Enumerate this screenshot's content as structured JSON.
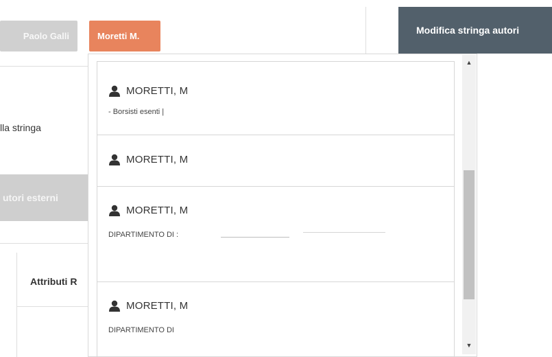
{
  "chips": {
    "first": "Paolo Galli",
    "selected": "Moretti M."
  },
  "modify_button": "Modifica stringa autori",
  "background": {
    "left_label": "lla stringa",
    "external_authors_button": "utori esterni",
    "table_header": "Attributi R"
  },
  "dropdown": {
    "items": [
      {
        "name": "MORETTI, M",
        "detail": "- Borsisti esenti |"
      },
      {
        "name": "MORETTI, M",
        "detail": ""
      },
      {
        "name": "MORETTI, M",
        "detail": "DIPARTIMENTO DI :"
      },
      {
        "name": "MORETTI, M",
        "detail": "DIPARTIMENTO DI"
      }
    ],
    "scroll_up_glyph": "▲",
    "scroll_down_glyph": "▼"
  },
  "colors": {
    "selected_chip": "#e8845d",
    "modify_button_bg": "#52606b",
    "inactive_chip": "#d0d0d0"
  },
  "icons": [
    "user-icon",
    "scroll-up-arrow-icon",
    "scroll-down-arrow-icon"
  ]
}
